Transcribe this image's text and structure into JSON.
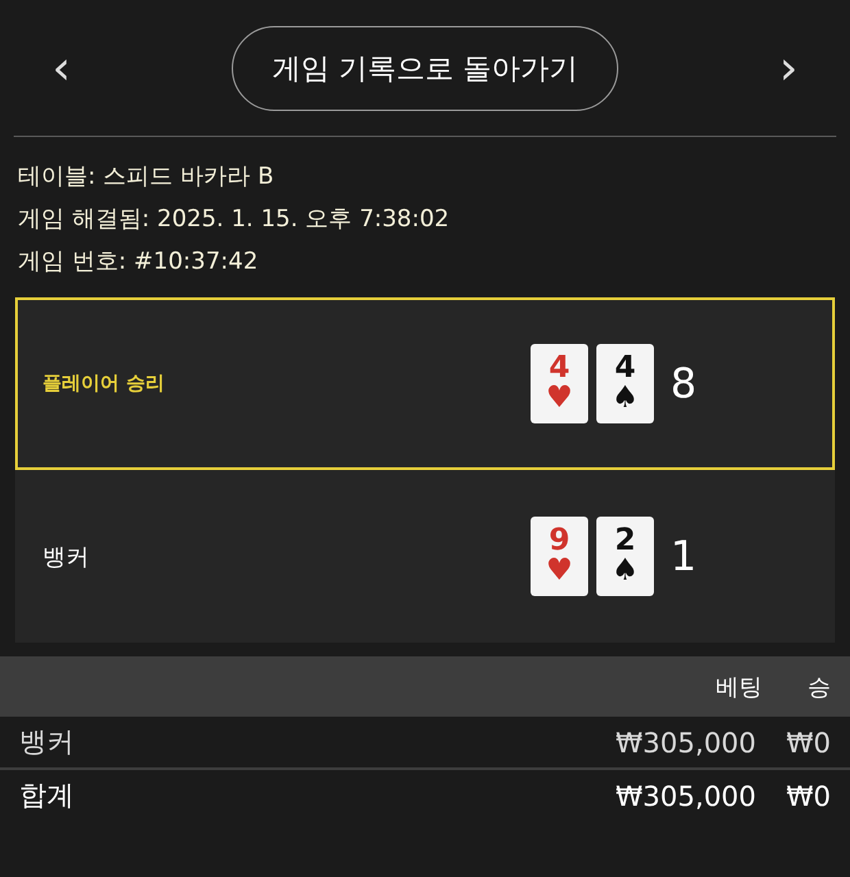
{
  "nav": {
    "prev": "‹",
    "next": "›",
    "back_button": "게임 기록으로 돌아가기"
  },
  "info": [
    "테이블: 스피드 바카라 B",
    "게임 해결됨: 2025. 1. 15. 오후 7:38:02",
    "게임 번호: #10:37:42"
  ],
  "hands": [
    {
      "label": "플레이어 승리",
      "winner": true,
      "score": "8",
      "cards": [
        {
          "rank": "4",
          "suit": "♥",
          "color": "#d0342c"
        },
        {
          "rank": "4",
          "suit": "♠",
          "color": "#111111"
        }
      ]
    },
    {
      "label": "뱅커",
      "winner": false,
      "score": "1",
      "cards": [
        {
          "rank": "9",
          "suit": "♥",
          "color": "#d0342c"
        },
        {
          "rank": "2",
          "suit": "♠",
          "color": "#111111"
        }
      ]
    }
  ],
  "bets": {
    "columns": [
      "",
      "베팅",
      "승"
    ],
    "rows": [
      {
        "kind": "item",
        "cells": [
          "뱅커",
          "₩305,000",
          "₩0"
        ]
      },
      {
        "kind": "total",
        "cells": [
          "합계",
          "₩305,000",
          "₩0"
        ]
      }
    ]
  }
}
